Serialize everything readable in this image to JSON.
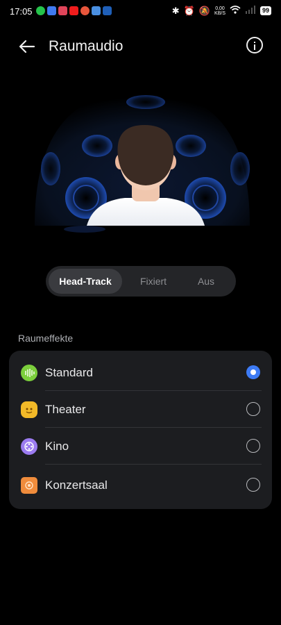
{
  "status_bar": {
    "time": "17:05",
    "net_speed_value": "0,00",
    "net_speed_unit": "KB/S",
    "battery": "99",
    "notification_icons": [
      "whatsapp-icon",
      "calendar-icon",
      "gift-icon",
      "youtube-icon",
      "avatar-app-icon",
      "mail-icon",
      "gmx-icon"
    ],
    "notification_colors": [
      "#25c34b",
      "#3f7af0",
      "#e0455a",
      "#f01c1c",
      "#e8563c",
      "#4a90e2",
      "#1f5fb8"
    ]
  },
  "app_bar": {
    "title": "Raumaudio"
  },
  "mode_selector": {
    "options": [
      "Head-Track",
      "Fixiert",
      "Aus"
    ],
    "selected": "Head-Track"
  },
  "effects": {
    "section_label": "Raumeffekte",
    "items": [
      {
        "label": "Standard",
        "icon": "soundwave-icon",
        "color": "#7ccf3c",
        "selected": true
      },
      {
        "label": "Theater",
        "icon": "theater-masks-icon",
        "color": "#f2b928",
        "selected": false
      },
      {
        "label": "Kino",
        "icon": "film-reel-icon",
        "color": "#9b7bf0",
        "selected": false
      },
      {
        "label": "Konzertsaal",
        "icon": "concert-hall-icon",
        "color": "#f08c3c",
        "selected": false
      }
    ]
  },
  "colors": {
    "accent": "#3d7bf5",
    "background": "#000000",
    "card": "#1c1d20"
  }
}
